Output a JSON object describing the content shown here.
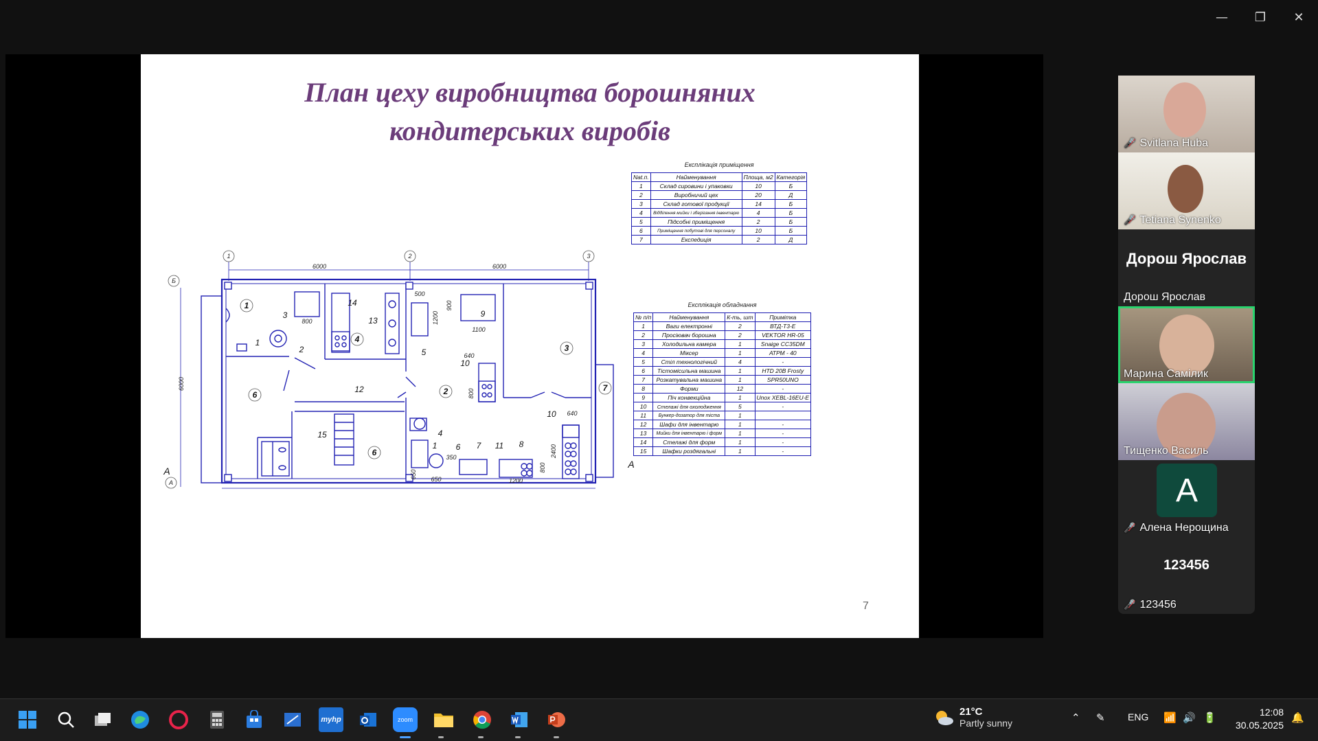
{
  "window": {
    "minimize_icon": "—",
    "restore_icon": "❐",
    "close_icon": "✕"
  },
  "slide": {
    "title_line1": "План цеху виробництва борошняних",
    "title_line2": "кондитерських виробів",
    "page_number": "7",
    "plan_labels": {
      "axis1": "1",
      "axis2": "2",
      "axis3": "3",
      "axisB": "Б",
      "axisA": "А",
      "dim_6000_a": "6000",
      "dim_6000_b": "6000",
      "dim_6000_v": "6000",
      "dim_800": "800",
      "dim_500": "500",
      "dim_900": "900",
      "dim_1200": "1200",
      "dim_1100": "1100",
      "dim_640a": "640",
      "dim_800b": "800",
      "dim_640b": "640",
      "dim_2400": "2400",
      "dim_350": "350",
      "dim_650a": "650",
      "dim_650b": "650",
      "dim_1200b": "1200",
      "dim_800c": "800",
      "section_A_left": "А",
      "section_A_right": "А",
      "n1": "1",
      "n2": "2",
      "n3": "3",
      "n4": "4",
      "n5": "5",
      "n6": "6",
      "n7": "7",
      "n8": "8",
      "n9": "9",
      "n10": "10",
      "n11": "11",
      "n12": "12",
      "n13": "13",
      "n14": "14",
      "n15": "15",
      "r1": "1",
      "r2": "2",
      "r3": "3",
      "r4": "4",
      "r6a": "6",
      "r6b": "6",
      "r7": "7",
      "e1": "1",
      "e4": "4",
      "e6": "6",
      "e7": "7",
      "e10": "10",
      "e1b": "1",
      "e2": "2",
      "e3": "3"
    },
    "rooms_table": {
      "caption": "Експлікація приміщення",
      "headers": [
        "Nat.п.",
        "Найменування",
        "Площа, м2",
        "Категорія"
      ],
      "rows": [
        [
          "1",
          "Склад сировини і упаковки",
          "10",
          "Б"
        ],
        [
          "2",
          "Виробничий цех",
          "20",
          "Д"
        ],
        [
          "3",
          "Склад готової продукції",
          "14",
          "Б"
        ],
        [
          "4",
          "Відділення мийки і зберігання інвентарю",
          "4",
          "Б"
        ],
        [
          "5",
          "Підсобні приміщення",
          "2",
          "Б"
        ],
        [
          "6",
          "Приміщення побутові для персоналу",
          "10",
          "Б"
        ],
        [
          "7",
          "Експедиція",
          "2",
          "Д"
        ]
      ]
    },
    "equipment_table": {
      "caption": "Експлікація обладнання",
      "headers": [
        "№ п/п",
        "Найменування",
        "К-ть, шт",
        "Примітка"
      ],
      "rows": [
        [
          "1",
          "Ваги електронні",
          "2",
          "ВТД-Т3-Е"
        ],
        [
          "2",
          "Просіювач борошна",
          "2",
          "VEKTOR HR-05"
        ],
        [
          "3",
          "Холодильна камера",
          "1",
          "Snaige CC35DM"
        ],
        [
          "4",
          "Міксер",
          "1",
          "АТРМ - 40"
        ],
        [
          "5",
          "Стіл технологічний",
          "4",
          "-"
        ],
        [
          "6",
          "Тістомісильна машина",
          "1",
          "HTD 20B Frosty"
        ],
        [
          "7",
          "Розкатувальна машина",
          "1",
          "SPR50UNO"
        ],
        [
          "8",
          "Форми",
          "12",
          "-"
        ],
        [
          "9",
          "Піч конвекційна",
          "1",
          "Unox XEBL-16EU-E"
        ],
        [
          "10",
          "Стелажі для охолодження",
          "5",
          "-"
        ],
        [
          "11",
          "Бункер-дозатор для тіста",
          "1",
          ""
        ],
        [
          "12",
          "Шафи для інвентарю",
          "1",
          "-"
        ],
        [
          "13",
          "Мийки для інвентарю і форм",
          "1",
          "-"
        ],
        [
          "14",
          "Стелажі для форм",
          "1",
          "-"
        ],
        [
          "15",
          "Шафки роздягальні",
          "1",
          "-"
        ]
      ]
    }
  },
  "participants": [
    {
      "name": "Svitlana Huba",
      "muted": true,
      "video": true
    },
    {
      "name": "Tetiana Synenko",
      "muted": true,
      "video": true
    },
    {
      "name": "Дорош Ярослав",
      "big": "Дорош Ярослав",
      "muted": false,
      "video": false
    },
    {
      "name": "Марина Самілик",
      "muted": false,
      "video": true,
      "active": true
    },
    {
      "name": "Тищенко Василь",
      "muted": false,
      "video": true
    },
    {
      "name": "Алена Нерощина",
      "avatar": "A",
      "muted": true,
      "video": false
    },
    {
      "name": "123456",
      "big": "123456",
      "muted": true,
      "video": false
    }
  ],
  "taskbar": {
    "icons": [
      "windows-start",
      "search",
      "task-view",
      "edge",
      "app-red-circle",
      "calculator",
      "store",
      "snipping",
      "myhp",
      "outlook",
      "zoom",
      "file-explorer",
      "chrome",
      "word",
      "powerpoint"
    ],
    "zoom_label": "zoom",
    "myhp_label": "myhp",
    "weather_temp": "21°C",
    "weather_desc": "Partly sunny",
    "lang": "ENG",
    "time": "12:08",
    "date": "30.05.2025"
  },
  "colors": {
    "plan_line": "#2222b3",
    "title": "#6b3c7a",
    "active_speaker": "#2ad46e",
    "muted": "#e0393e"
  }
}
